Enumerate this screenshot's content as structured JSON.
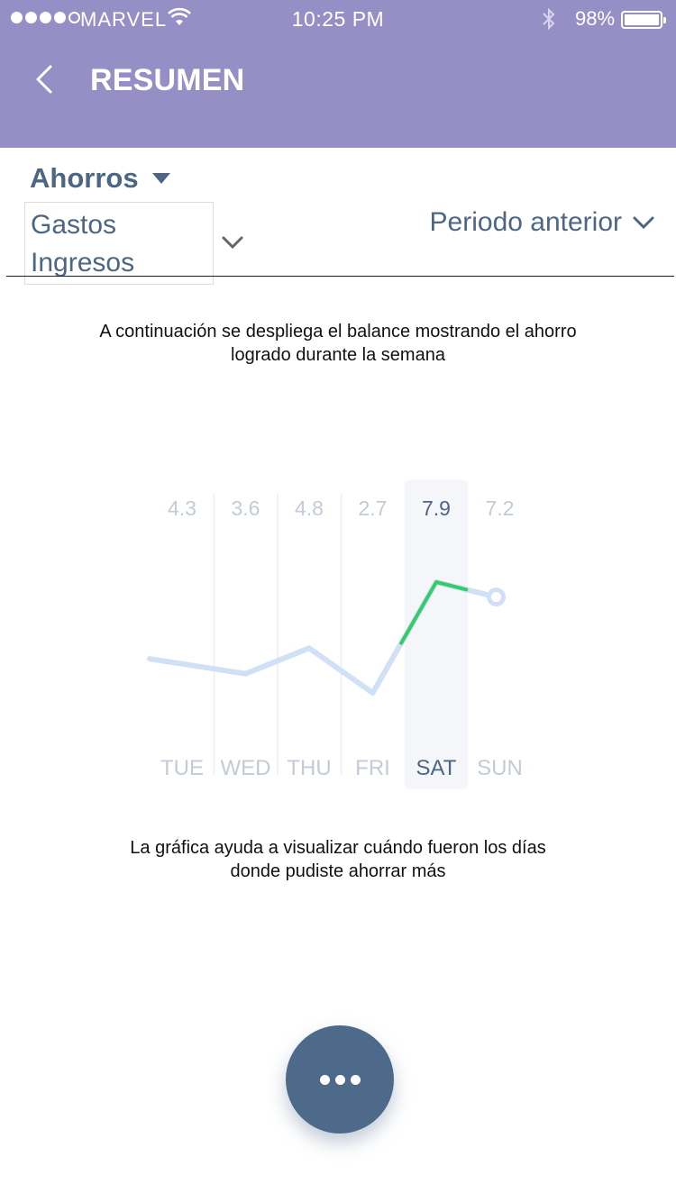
{
  "status_bar": {
    "carrier": "MARVEL",
    "time": "10:25 PM",
    "battery_pct": "98%",
    "battery_level": 0.98,
    "signal_bars_filled": 4,
    "signal_bars_total": 5
  },
  "header": {
    "title": "RESUMEN",
    "back_icon": "chevron-left-icon",
    "background_color": "#968fc5"
  },
  "filters": {
    "type_selected": "Ahorros",
    "type_options": [
      "Gastos",
      "Ingresos"
    ],
    "period": "Periodo anterior"
  },
  "texts": {
    "intro": "A continuación se despliega el balance mostrando el ahorro logrado durante la semana",
    "footer": "La gráfica ayuda a visualizar cuándo fueron los días donde pudiste ahorrar más"
  },
  "chart_data": {
    "type": "line",
    "categories": [
      "TUE",
      "WED",
      "THU",
      "FRI",
      "SAT",
      "SUN"
    ],
    "values": [
      4.3,
      3.6,
      4.8,
      2.7,
      7.9,
      7.2
    ],
    "highlighted_category": "SAT",
    "colors": {
      "line": "#cfe0f7",
      "highlight_line": "#33cc66",
      "label": "#c3cbd6",
      "label_active": "#4c6683",
      "highlight_band": "#f4f6f9",
      "divider": "#eeeeee"
    }
  },
  "fab": {
    "icon": "more-dots-icon",
    "color": "#4e6a8a"
  }
}
